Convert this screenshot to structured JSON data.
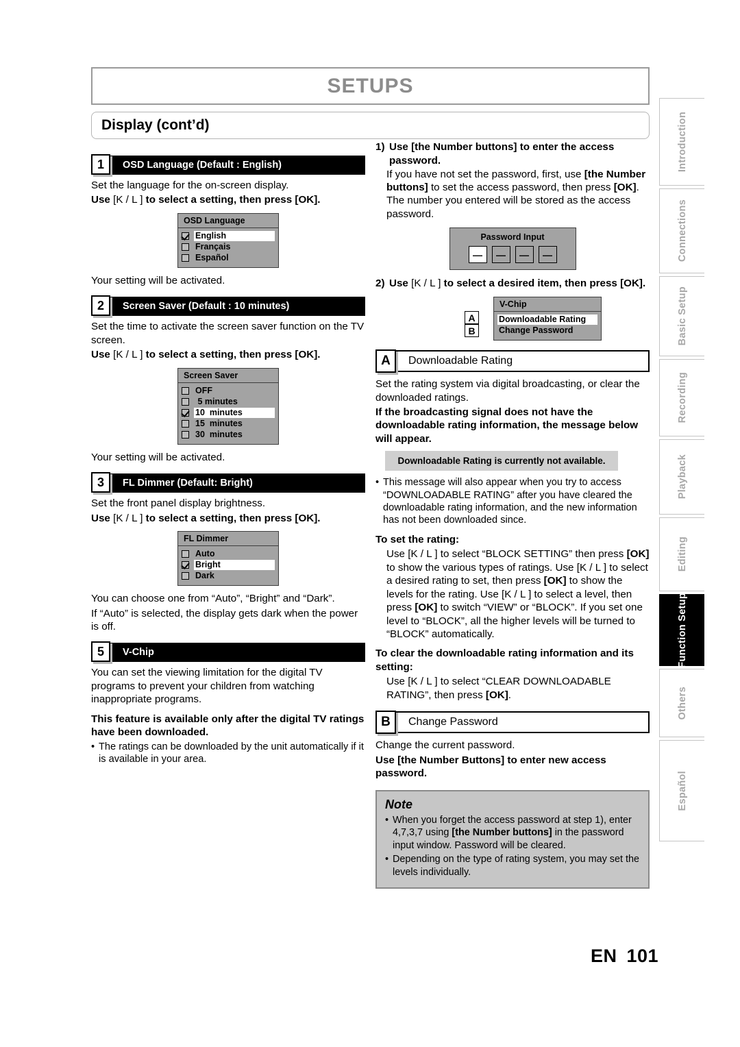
{
  "header": {
    "title": "SETUPS",
    "subtitle": "Display (cont’d)"
  },
  "footer": {
    "lang_code": "EN",
    "page_number": "101"
  },
  "tabs": [
    {
      "label": "Introduction",
      "active": false
    },
    {
      "label": "Connections",
      "active": false
    },
    {
      "label": "Basic Setup",
      "active": false
    },
    {
      "label": "Recording",
      "active": false
    },
    {
      "label": "Playback",
      "active": false
    },
    {
      "label": "Editing",
      "active": false
    },
    {
      "label": "Function Setup",
      "active": true
    },
    {
      "label": "Others",
      "active": false
    },
    {
      "label": "Español",
      "active": false
    }
  ],
  "left_column": {
    "step1": {
      "number": "1",
      "title": "OSD Language (Default : English)",
      "desc": "Set the language for the on-screen display.",
      "instruction_pre": "Use ",
      "instruction_keys": "[K / L ]",
      "instruction_post": " to select a setting, then press [OK].",
      "menu": {
        "title": "OSD Language",
        "rows": [
          {
            "label": "English",
            "checked": true
          },
          {
            "label": "Français",
            "checked": false
          },
          {
            "label": "Español",
            "checked": false
          }
        ]
      },
      "after": "Your setting will be activated."
    },
    "step2": {
      "number": "2",
      "title": "Screen Saver (Default : 10 minutes)",
      "desc": "Set the time to activate the screen saver function on the TV screen.",
      "instruction_pre": "Use ",
      "instruction_keys": "[K / L ]",
      "instruction_post": " to select a setting, then press [OK].",
      "menu": {
        "title": "Screen Saver",
        "rows": [
          {
            "label": "OFF",
            "checked": false
          },
          {
            "label": " 5 minutes",
            "checked": false
          },
          {
            "label": "10  minutes",
            "checked": true
          },
          {
            "label": "15  minutes",
            "checked": false
          },
          {
            "label": "30  minutes",
            "checked": false
          }
        ]
      },
      "after": "Your setting will be activated."
    },
    "step3": {
      "number": "3",
      "title": "FL Dimmer (Default: Bright)",
      "desc": "Set the front panel display brightness.",
      "instruction_pre": "Use ",
      "instruction_keys": "[K / L ]",
      "instruction_post": " to select a setting, then press [OK].",
      "menu": {
        "title": "FL Dimmer",
        "rows": [
          {
            "label": "Auto",
            "checked": false
          },
          {
            "label": "Bright",
            "checked": true
          },
          {
            "label": "Dark",
            "checked": false
          }
        ]
      },
      "after_1": "You can choose one from “Auto”, “Bright” and “Dark”.",
      "after_2": "If “Auto” is selected, the display gets dark when the power is off."
    },
    "step5": {
      "number": "5",
      "title": "V-Chip",
      "desc": "You can set the viewing limitation for the digital TV programs to prevent your children from watching inappropriate programs.",
      "bold_note": "This feature is available only after the digital TV ratings have been downloaded.",
      "bullet": "The ratings can be downloaded by the unit automatically if it is available in your area."
    }
  },
  "right_column": {
    "step_1": {
      "marker": "1)",
      "title": "Use [the Number buttons] to enter the access password.",
      "body_1": "If you have not set the password, first, use ",
      "body_1_bold": "[the Number buttons]",
      "body_2": " to set the access password, then press ",
      "body_2_bold": "[OK]",
      "body_3": ". The number you entered will be stored as the access password.",
      "password_menu": {
        "title": "Password Input",
        "digits": [
          "—",
          "—",
          "—",
          "—"
        ],
        "active_index": 0
      }
    },
    "step_2": {
      "marker": "2)",
      "title_pre": "Use ",
      "title_keys": "[K / L ]",
      "title_post": " to select a desired item, then press [OK].",
      "vchip_menu": {
        "title": "V-Chip",
        "rows": [
          {
            "marker": "A",
            "label": "Downloadable Rating",
            "selected": true
          },
          {
            "marker": "B",
            "label": "Change Password",
            "selected": false
          }
        ]
      }
    },
    "section_a": {
      "letter": "A",
      "title": "Downloadable Rating",
      "desc": "Set the rating system via digital broadcasting, or clear the downloaded ratings.",
      "bold_note": "If the broadcasting signal does not have the downloadable rating information, the message below will appear.",
      "message": "Downloadable Rating is currently not available.",
      "bullet": "This message will also appear when you try to access “DOWNLOADABLE RATING” after you have cleared the downloadable rating information, and the new information has not been downloaded since.",
      "set_rating_heading": "To set the rating:",
      "set_rating_body_1": "Use ",
      "set_rating_keys_1": "[K / L ]",
      "set_rating_body_2": " to select “BLOCK SETTING” then press ",
      "set_rating_ok_1": "[OK]",
      "set_rating_body_3": " to show the various types of ratings. Use ",
      "set_rating_keys_2": "[K / L ]",
      "set_rating_body_4": " to select a desired rating to set, then press ",
      "set_rating_ok_2": "[OK]",
      "set_rating_body_5": " to show the levels for the rating. Use ",
      "set_rating_keys_3": "[K / L ]",
      "set_rating_body_6": " to select a level, then press ",
      "set_rating_ok_3": "[OK]",
      "set_rating_body_7": " to switch “VIEW” or “BLOCK”. If you set one level to “BLOCK”, all the higher levels will be turned to “BLOCK” automatically.",
      "clear_heading": "To clear the downloadable rating information and its setting:",
      "clear_body_1": "Use ",
      "clear_keys": "[K / L ]",
      "clear_body_2": " to select “CLEAR DOWNLOADABLE RATING”, then press ",
      "clear_ok": "[OK]",
      "clear_body_3": "."
    },
    "section_b": {
      "letter": "B",
      "title": "Change Password",
      "desc": "Change the current password.",
      "bold_note": "Use [the Number Buttons] to enter new access password."
    },
    "note": {
      "title": "Note",
      "bullet_1_pre": "When you forget the access password at step 1), enter 4,7,3,7 using ",
      "bullet_1_bold": "[the Number buttons]",
      "bullet_1_post": " in the password input window. Password will be cleared.",
      "bullet_2": "Depending on the type of rating system, you may set the levels individually."
    }
  }
}
